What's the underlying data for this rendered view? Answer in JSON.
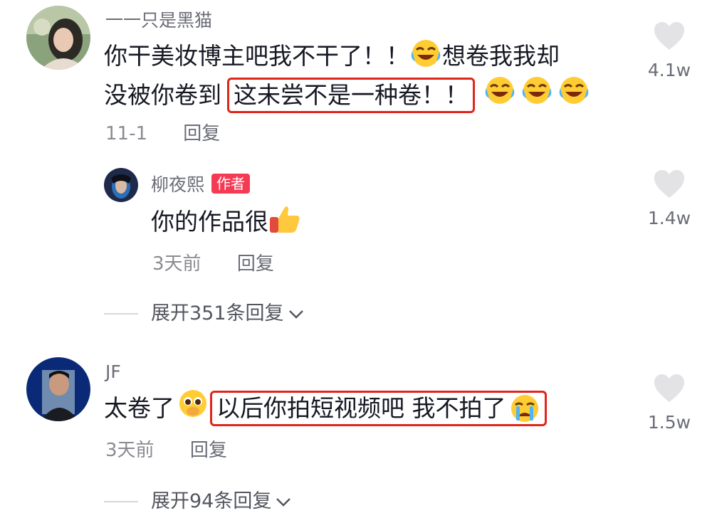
{
  "comments": [
    {
      "username": "一一只是黑猫",
      "text_line1": "你干美妆博主吧我不干了！！",
      "text_line1b": "想卷我我却",
      "text_line2": "没被你卷到",
      "text_highlight": "这未尝不是一种卷！！",
      "date": "11-1",
      "reply_label": "回复",
      "likes": "4.1w",
      "emoji": "crying-laughing-emoji"
    },
    {
      "username": "柳夜熙",
      "badge": "作者",
      "text": "你的作品很",
      "emoji": "thumbs-up-emoji",
      "date": "3天前",
      "reply_label": "回复",
      "likes": "1.4w"
    },
    {
      "username": "JF",
      "text": "太卷了",
      "text_highlight": "以后你拍短视频吧 我不拍了",
      "date": "3天前",
      "reply_label": "回复",
      "likes": "1.5w",
      "emoji": "pleading-face-emoji"
    }
  ],
  "expand_replies": [
    {
      "label": "展开351条回复"
    },
    {
      "label": "展开94条回复"
    }
  ],
  "colors": {
    "highlight_border": "#e0251b",
    "author_badge": "#f53b54",
    "heart": "#e3e3e6"
  }
}
